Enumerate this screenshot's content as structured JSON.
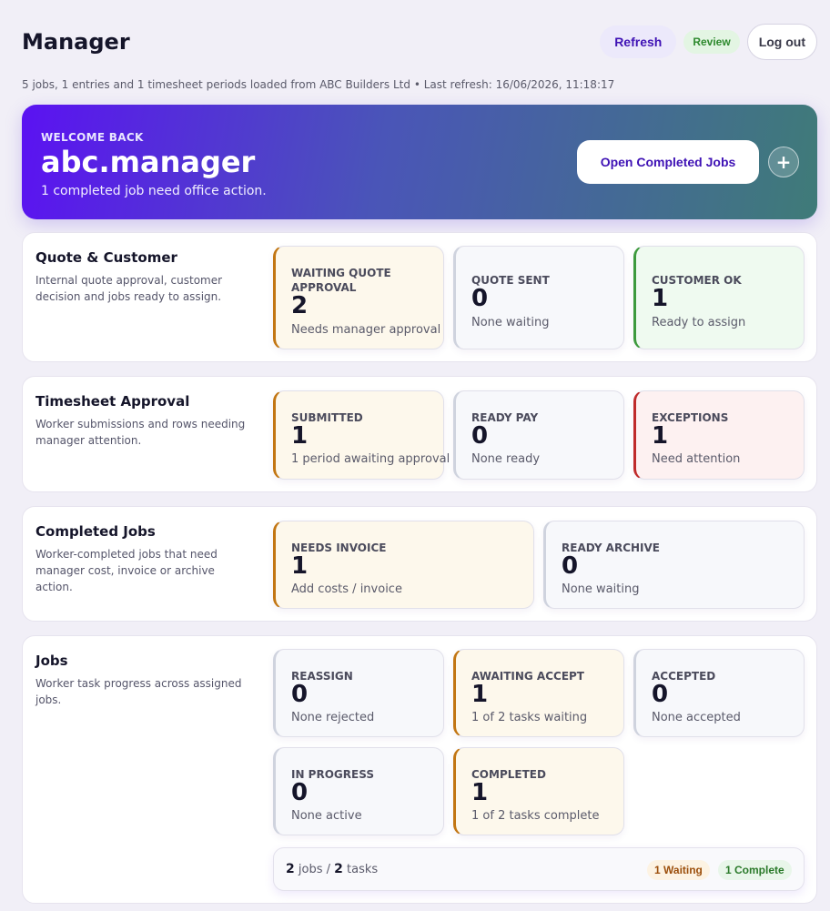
{
  "header": {
    "title": "Manager",
    "refresh_label": "Refresh",
    "review_label": "Review",
    "logout_label": "Log out"
  },
  "subtitle": "5 jobs, 1 entries and 1 timesheet periods loaded from ABC Builders Ltd • Last refresh: 16/06/2026, 11:18:17",
  "hero": {
    "eyebrow": "WELCOME BACK",
    "username": "abc.manager",
    "message": "1 completed job need office action.",
    "button_label": "Open Completed Jobs",
    "plus_symbol": "+"
  },
  "sections": {
    "quote": {
      "title": "Quote & Customer",
      "description": "Internal quote approval, customer decision and jobs ready to assign.",
      "cards": [
        {
          "label": "WAITING QUOTE APPROVAL",
          "value": "2",
          "note": "Needs manager approval"
        },
        {
          "label": "QUOTE SENT",
          "value": "0",
          "note": "None waiting"
        },
        {
          "label": "CUSTOMER OK",
          "value": "1",
          "note": "Ready to assign"
        }
      ]
    },
    "timesheet": {
      "title": "Timesheet Approval",
      "description": "Worker submissions and rows needing manager attention.",
      "cards": [
        {
          "label": "SUBMITTED",
          "value": "1",
          "note": "1 period awaiting approval"
        },
        {
          "label": "READY PAY",
          "value": "0",
          "note": "None ready"
        },
        {
          "label": "EXCEPTIONS",
          "value": "1",
          "note": "Need attention"
        }
      ]
    },
    "completed": {
      "title": "Completed Jobs",
      "description": "Worker-completed jobs that need manager cost, invoice or archive action.",
      "cards": [
        {
          "label": "NEEDS INVOICE",
          "value": "1",
          "note": "Add costs / invoice"
        },
        {
          "label": "READY ARCHIVE",
          "value": "0",
          "note": "None waiting"
        }
      ]
    },
    "jobs": {
      "title": "Jobs",
      "description": "Worker task progress across assigned jobs.",
      "cards": [
        {
          "label": "REASSIGN",
          "value": "0",
          "note": "None rejected"
        },
        {
          "label": "AWAITING ACCEPT",
          "value": "1",
          "note": "1 of 2 tasks waiting"
        },
        {
          "label": "ACCEPTED",
          "value": "0",
          "note": "None accepted"
        },
        {
          "label": "IN PROGRESS",
          "value": "0",
          "note": "None active"
        },
        {
          "label": "COMPLETED",
          "value": "1",
          "note": "1 of 2 tasks complete"
        }
      ],
      "summary": {
        "jobs_count": "2",
        "jobs_label": "jobs /",
        "tasks_count": "2",
        "tasks_label": "tasks",
        "waiting_pill": "1 Waiting",
        "complete_pill": "1 Complete"
      }
    }
  }
}
